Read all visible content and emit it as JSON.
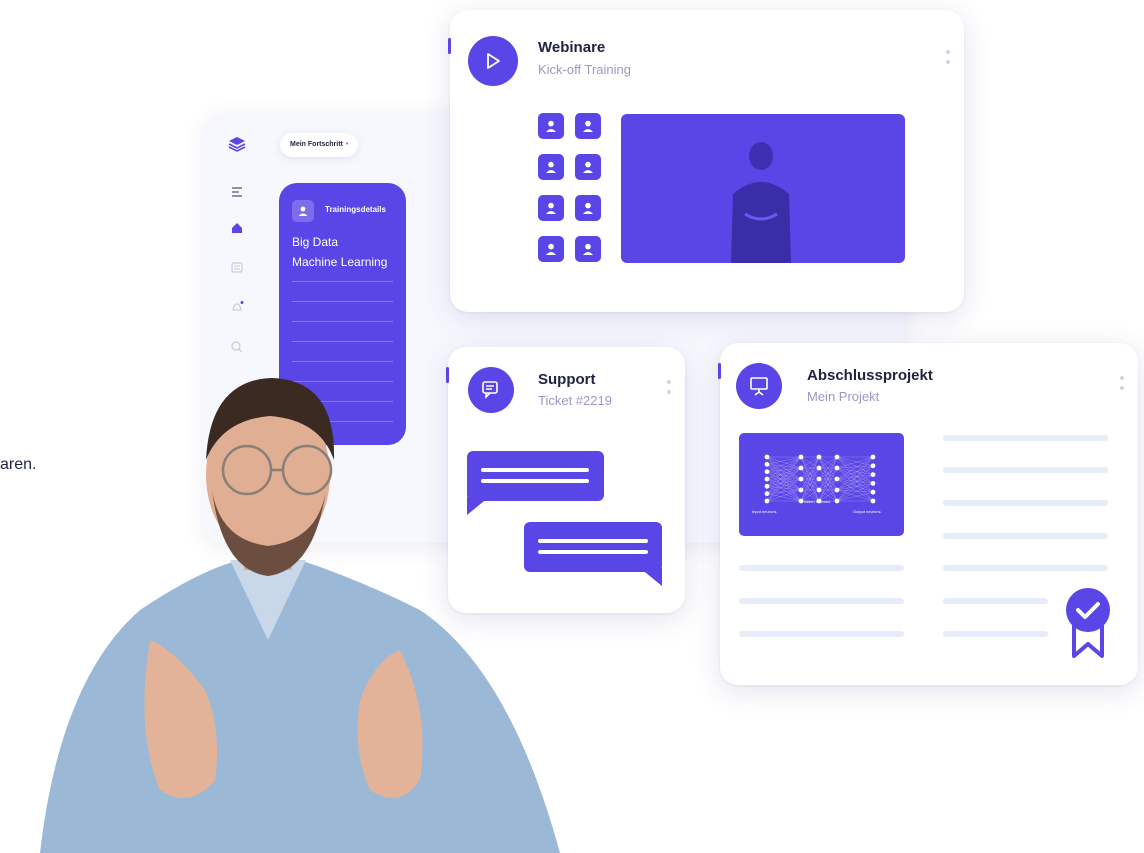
{
  "side_text": "aren.",
  "dashboard": {
    "progress_label": "Mein Fortschritt",
    "progress_marker": "•",
    "training_title": "Trainingsdetails",
    "courses": [
      "Big Data",
      "Machine Learning"
    ]
  },
  "webinar": {
    "title": "Webinare",
    "subtitle": "Kick-off Training"
  },
  "support": {
    "title": "Support",
    "subtitle": "Ticket #2219"
  },
  "project": {
    "title": "Abschlussprojekt",
    "subtitle": "Mein Projekt",
    "network_labels": [
      "Input neurons",
      "Hidden neurons",
      "Output neurons"
    ]
  },
  "colors": {
    "accent": "#5a45e6",
    "muted_text": "#9a98c7",
    "placeholder_bar": "#e8ebf8",
    "notification_dot": "#e64a72"
  },
  "icons": {
    "dashboard_logo": "layers-icon",
    "menu": "menu-icon",
    "home": "home-icon",
    "calendar": "calendar-icon",
    "notifications": "bell-icon",
    "search": "search-icon",
    "webinar": "play-icon",
    "support": "chat-icon",
    "project": "presentation-icon",
    "certificate": "award-badge-icon"
  }
}
